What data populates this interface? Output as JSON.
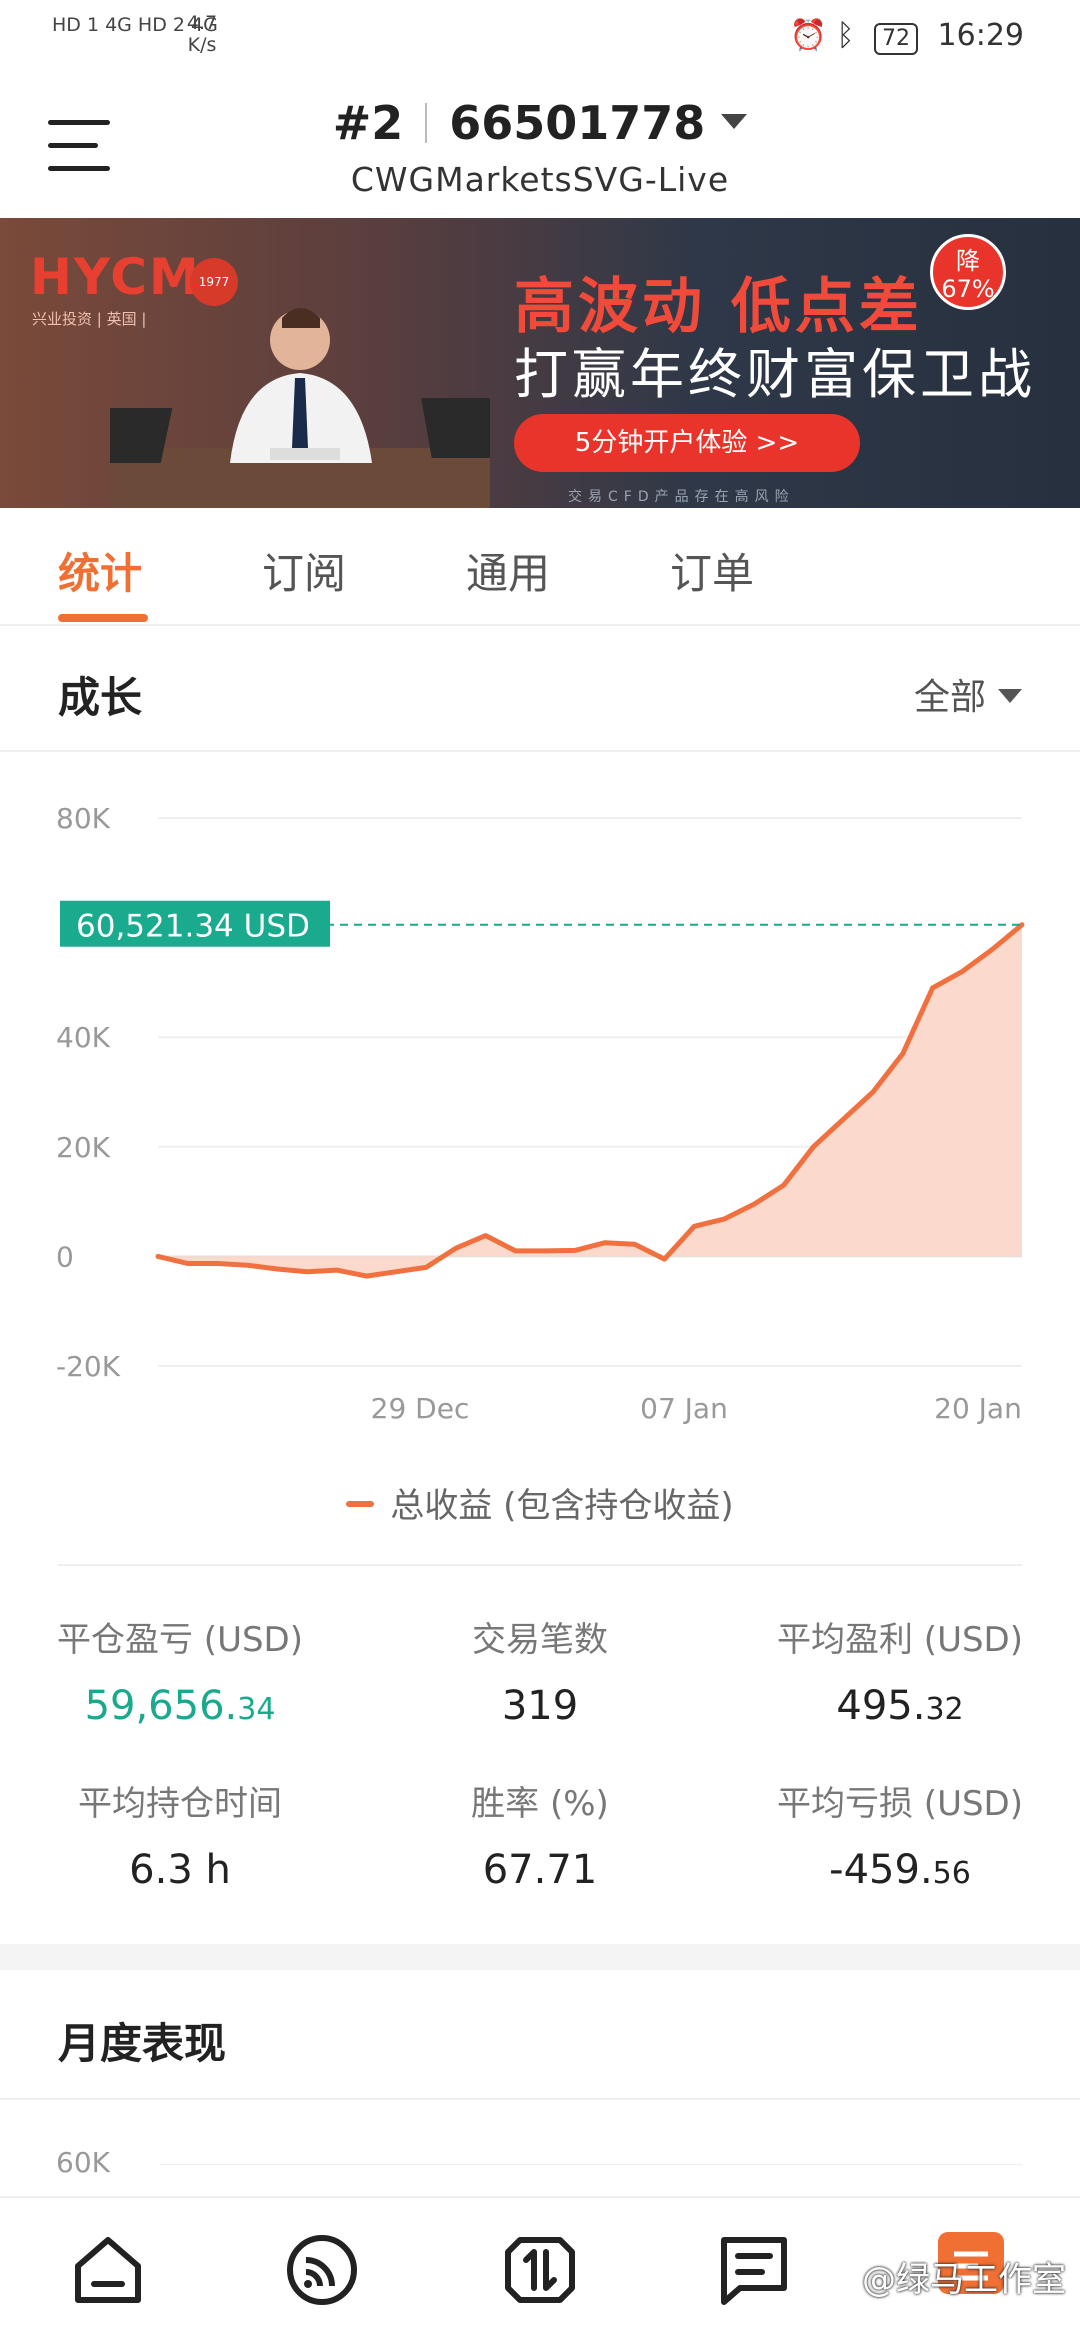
{
  "status_bar": {
    "network_left": "HD 1 4G  HD 2 4G",
    "speed": "4.7",
    "speed_unit": "K/s",
    "battery": "72",
    "time": "16:29"
  },
  "header": {
    "account_number": "#2",
    "account_id": "66501778",
    "server": "CWGMarketsSVG-Live"
  },
  "banner": {
    "brand": "HYCM",
    "brand_sub": "兴业投资 | 英国 |",
    "seal": "1977",
    "headline": "高波动 低点差",
    "subheadline": "打赢年终财富保卫战",
    "cta": "5分钟开户体验 >>",
    "badge_top": "降",
    "badge_bottom": "67%",
    "fine_print": "交易CFD产品存在高风险"
  },
  "tabs": [
    {
      "label": "统计"
    },
    {
      "label": "订阅"
    },
    {
      "label": "通用"
    },
    {
      "label": "订单"
    }
  ],
  "growth": {
    "title": "成长",
    "filter": "全部"
  },
  "chart_data": {
    "type": "area",
    "y_ticks": [
      "80K",
      "40K",
      "20K",
      "0",
      "-20K"
    ],
    "x_ticks": [
      "29 Dec",
      "07 Jan",
      "20 Jan"
    ],
    "ylim": [
      -20000,
      80000
    ],
    "current_value_label": "60,521.34 USD",
    "current_value": 60521.34,
    "legend": "总收益 (包含持仓收益)",
    "series": [
      {
        "name": "总收益 (包含持仓收益)",
        "values": [
          0,
          -1300,
          -1300,
          -1600,
          -2300,
          -2800,
          -2500,
          -3600,
          -2800,
          -2000,
          1500,
          3800,
          1000,
          1000,
          1100,
          2500,
          2200,
          -500,
          5500,
          6800,
          9500,
          13000,
          20000,
          25000,
          30000,
          37000,
          49000,
          52000,
          56000,
          60521.34
        ]
      }
    ],
    "line_color": "#f07040",
    "fill_color": "#fbd5c6",
    "marker_color": "#1aaa8e",
    "grid": true
  },
  "stats": [
    {
      "label": "平仓盈亏 (USD)",
      "int": "59,656.",
      "dec": "34",
      "green": true
    },
    {
      "label": "交易笔数",
      "int": "319",
      "dec": "",
      "green": false
    },
    {
      "label": "平均盈利 (USD)",
      "int": "495.",
      "dec": "32",
      "green": false
    },
    {
      "label": "平均持仓时间",
      "int": "6.3 h",
      "dec": "",
      "green": false
    },
    {
      "label": "胜率 (%)",
      "int": "67.71",
      "dec": "",
      "green": false
    },
    {
      "label": "平均亏损 (USD)",
      "int": "-459.",
      "dec": "56",
      "green": false
    }
  ],
  "monthly": {
    "title": "月度表现",
    "first_tick": "60K"
  },
  "bottom_nav": [
    {
      "icon": "home-icon"
    },
    {
      "icon": "signal-icon"
    },
    {
      "icon": "trade-icon"
    },
    {
      "icon": "news-icon"
    },
    {
      "icon": "profile-icon"
    }
  ],
  "watermark": "@绿马工作室"
}
